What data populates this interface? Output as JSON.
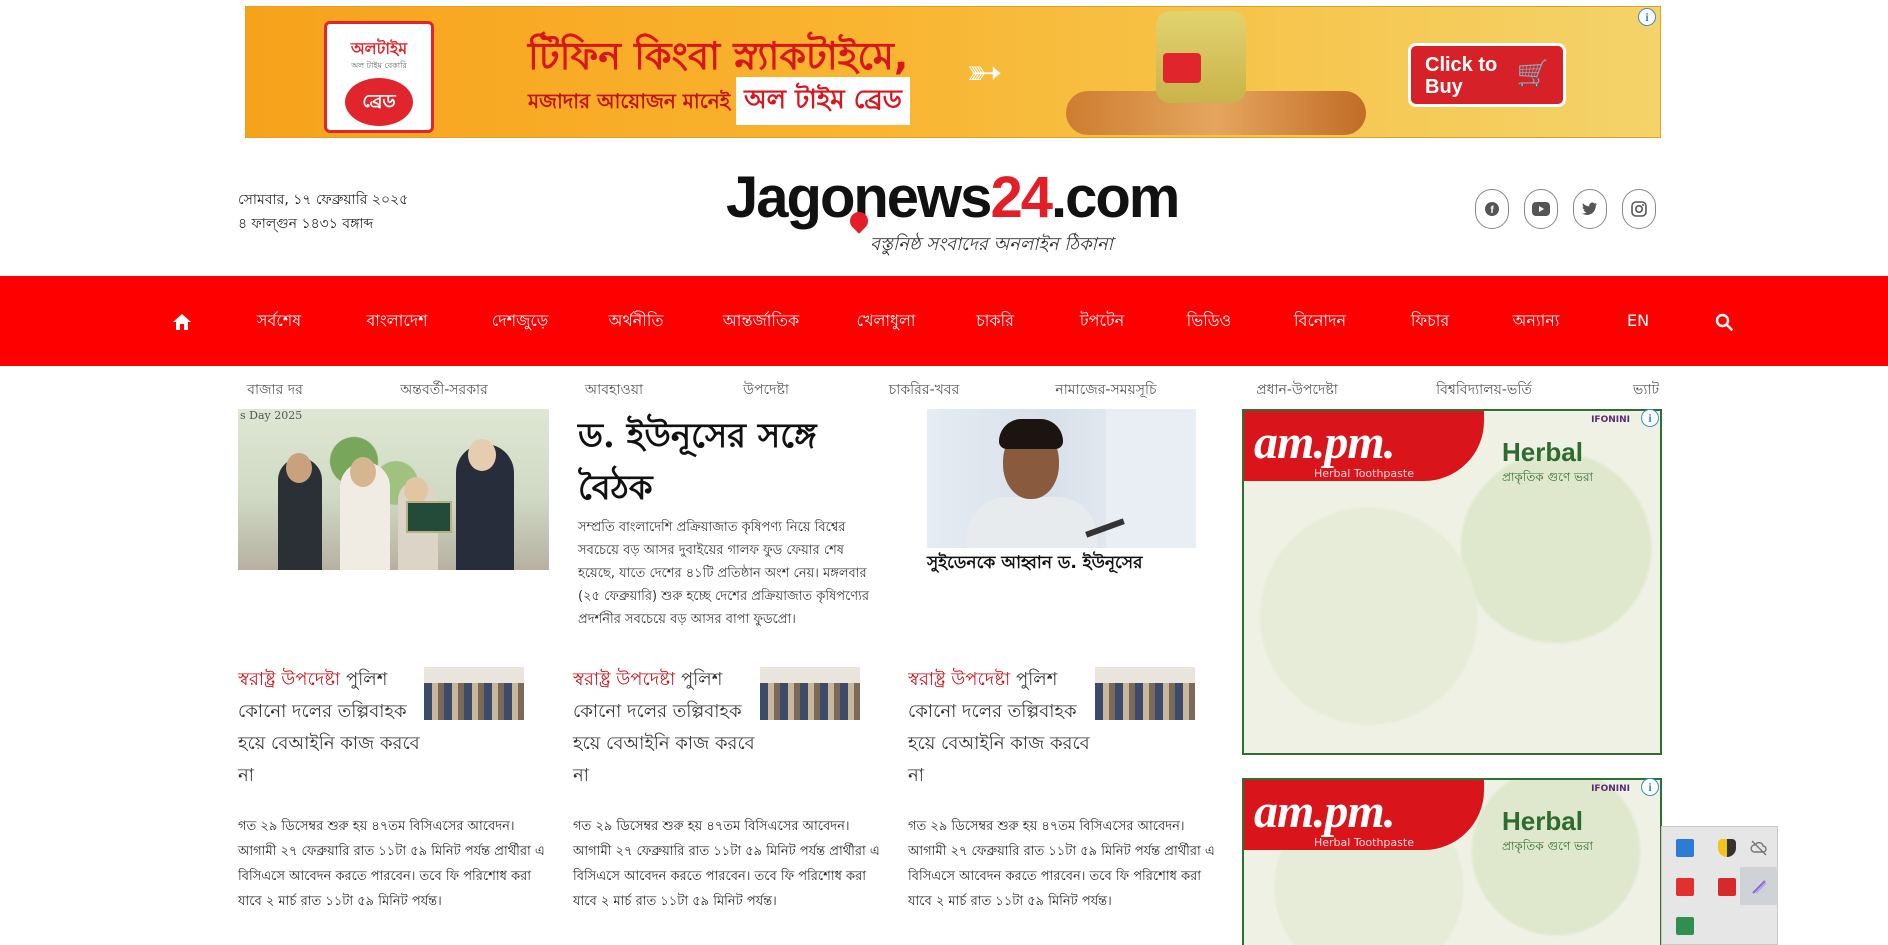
{
  "top_ad": {
    "brand_top": "অলটাইম",
    "brand_mid": "অল টাইম বেকারি",
    "brand_circle": "ব্রেড",
    "line1": "টিফিন কিংবা স্ন্যাকটাইমে,",
    "line2": "মজাদার আয়োজন মানেই",
    "line2_highlight": "অল টাইম ব্রেড",
    "button": "Click to Buy",
    "colors": {
      "background": "#f7a21b",
      "button": "#d72128"
    }
  },
  "header": {
    "date_gregorian": "সোমবার, ১৭ ফেব্রুয়ারি ২০২৫",
    "date_bangla": "৪ ফাল্গুন ১৪৩১ বঙ্গাব্দ",
    "logo": {
      "part1": "Jago",
      "part2": "news",
      "part3": "24",
      "part4": ".com",
      "tagline": "বস্তুনিষ্ঠ সংবাদের অনলাইন ঠিকানা"
    },
    "social": [
      {
        "name": "facebook-icon",
        "glyph": "f"
      },
      {
        "name": "youtube-icon",
        "glyph": "▶"
      },
      {
        "name": "twitter-icon",
        "glyph": "🐦"
      },
      {
        "name": "instagram-icon",
        "glyph": "◎"
      }
    ]
  },
  "nav": {
    "color": "#ff0000",
    "items": [
      "সর্বশেষ",
      "বাংলাদেশ",
      "দেশজুড়ে",
      "অর্থনীতি",
      "আন্তর্জাতিক",
      "খেলাধুলা",
      "চাকরি",
      "টপটেন",
      "ভিডিও",
      "বিনোদন",
      "ফিচার",
      "অন্যান্য",
      "EN"
    ]
  },
  "tags": [
    "বাজার দর",
    "অন্তবর্তী-সরকার",
    "আবহাওয়া",
    "উপদেষ্টা",
    "চাকরির-খবর",
    "নামাজের-সময়সূচি",
    "প্রধান-উপদেষ্টা",
    "বিশ্ববিদ্যালয়-ভর্তি",
    "ভ্যাট"
  ],
  "lead": {
    "title": "ড. ইউনূসের সঙ্গে বৈঠক",
    "description": "সম্প্রতি বাংলাদেশি প্রক্রিয়াজাত কৃষিপণ্য নিয়ে বিশ্বের সবচেয়ে বড় আসর দুবাইয়ের গালফ ফুড ফেয়ার শেষ হয়েছে, যাতে দেশের ৪১টি প্রতিষ্ঠান অংশ নেয়। মঙ্গলবার (২৫ ফেব্রুয়ারি) শুরু হচ্ছে দেশের প্রক্রিয়াজাত কৃষিপণ্যের প্রদর্শনীর সবচেয়ে বড় আসর বাপা ফুডপ্রো।",
    "image_caption": "s Day 2025"
  },
  "side_story": {
    "title": "সুইডেনকে আহ্বান ড. ইউনূসের"
  },
  "cards": [
    {
      "title_red": "স্বরাষ্ট্র উপদেষ্টা",
      "title_rest": " পুলিশ কোনো দলের তল্পিবাহক হয়ে বেআইনি কাজ করবে না",
      "body": "গত ২৯ ডিসেম্বর শুরু হয় ৪৭তম বিসিএসের আবেদন। আগামী ২৭ ফেব্রুয়ারি রাত ১১টা ৫৯ মিনিট পর্যন্ত প্রার্থীরা এ বিসিএসে আবেদন করতে পারবেন। তবে ফি পরিশোধ করা যাবে ২ মার্চ রাত ১১টা ৫৯ মিনিট পর্যন্ত।"
    },
    {
      "title_red": "স্বরাষ্ট্র উপদেষ্টা",
      "title_rest": " পুলিশ কোনো দলের তল্পিবাহক হয়ে বেআইনি কাজ করবে না",
      "body": "গত ২৯ ডিসেম্বর শুরু হয় ৪৭তম বিসিএসের আবেদন। আগামী ২৭ ফেব্রুয়ারি রাত ১১টা ৫৯ মিনিট পর্যন্ত প্রার্থীরা এ বিসিএসে আবেদন করতে পারবেন। তবে ফি পরিশোধ করা যাবে ২ মার্চ রাত ১১টা ৫৯ মিনিট পর্যন্ত।"
    },
    {
      "title_red": "স্বরাষ্ট্র উপদেষ্টা",
      "title_rest": " পুলিশ কোনো দলের তল্পিবাহক হয়ে বেআইনি কাজ করবে না",
      "body": "গত ২৯ ডিসেম্বর শুরু হয় ৪৭তম বিসিএসের আবেদন। আগামী ২৭ ফেব্রুয়ারি রাত ১১টা ৫৯ মিনিট পর্যন্ত প্রার্থীরা এ বিসিএসে আবেদন করতে পারবেন। তবে ফি পরিশোধ করা যাবে ২ মার্চ রাত ১১টা ৫৯ মিনিট পর্যন্ত।"
    }
  ],
  "side_ads": [
    {
      "brand": "am.pm.",
      "sub": "Herbal Toothpaste",
      "herbal": "Herbal",
      "herbal_sub": "প্রাকৃতিক গুণে ভরা",
      "mini_logo": "IFONINI"
    },
    {
      "brand": "am.pm.",
      "sub": "Herbal Toothpaste",
      "herbal": "Herbal",
      "herbal_sub": "প্রাকৃতিক গুণে ভরা",
      "mini_logo": "IFONINI"
    }
  ],
  "tray": {
    "icons": [
      {
        "name": "monitor-app-icon",
        "color": "#2e7bd6"
      },
      {
        "name": "security-shield-icon",
        "color": "#f0c419"
      },
      {
        "name": "cloud-off-icon",
        "color": "#777777"
      },
      {
        "name": "speaker-app-icon",
        "color": "#e03030"
      },
      {
        "name": "pdf-reader-icon",
        "color": "#d62a2a"
      },
      {
        "name": "feather-pen-icon",
        "color": "#8a6ad6"
      },
      {
        "name": "font-tool-icon",
        "color": "#2f8f4f"
      }
    ]
  }
}
